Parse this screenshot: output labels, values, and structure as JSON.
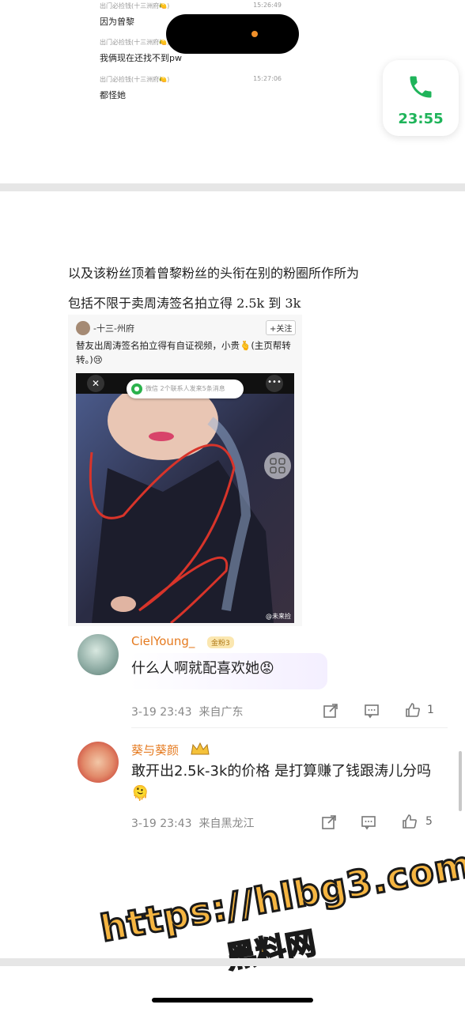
{
  "chat": {
    "messages": [
      {
        "sender": "出门必捡钱(十三洲府🍋)",
        "time": "15:26:49",
        "text": "因为曾黎"
      },
      {
        "sender": "出门必捡钱(十三洲府🍋)",
        "time": "",
        "text": "我俩现在还找不到pw"
      },
      {
        "sender": "出门必捡钱(十三洲府🍋)",
        "time": "15:27:06",
        "text": "都怪她"
      }
    ],
    "call_timer": "23:55"
  },
  "article": {
    "line1": "以及该粉丝顶着曾黎粉丝的头衔在别的粉圈所作所为",
    "line2": "包括不限于卖周涛签名拍立得 2.5k 到 3k"
  },
  "embedded_post": {
    "username": "-十三-州府",
    "follow_label": "+关注",
    "text": "替友出周涛签名拍立得有自证视频，小贵🫰(主页帮转转。)😢",
    "video": {
      "close_label": "✕",
      "more_label": "•••",
      "wechat_title": "微信",
      "wechat_text": "2个联系人发来5条消息",
      "watermark": "@未来捡"
    }
  },
  "comments": [
    {
      "username": "CielYoung_",
      "badge": "金粉3",
      "text": "什么人啊就配喜欢她😡",
      "timestamp": "3-19 23:43",
      "location": "来自广东",
      "like_count": "1"
    },
    {
      "username": "葵与葵颜",
      "badge": "",
      "text": "敢开出2.5k-3k的价格 是打算赚了钱跟涛儿分吗🫠",
      "timestamp": "3-19 23:43",
      "location": "来自黑龙江",
      "like_count": "5"
    }
  ],
  "watermark_overlay": {
    "line1": "https://hlbg3.com",
    "line2": "黑料网"
  },
  "colors": {
    "call_green": "#1fb45a",
    "username_orange": "#e57a1f",
    "watermark_yellow": "#f5b541"
  }
}
